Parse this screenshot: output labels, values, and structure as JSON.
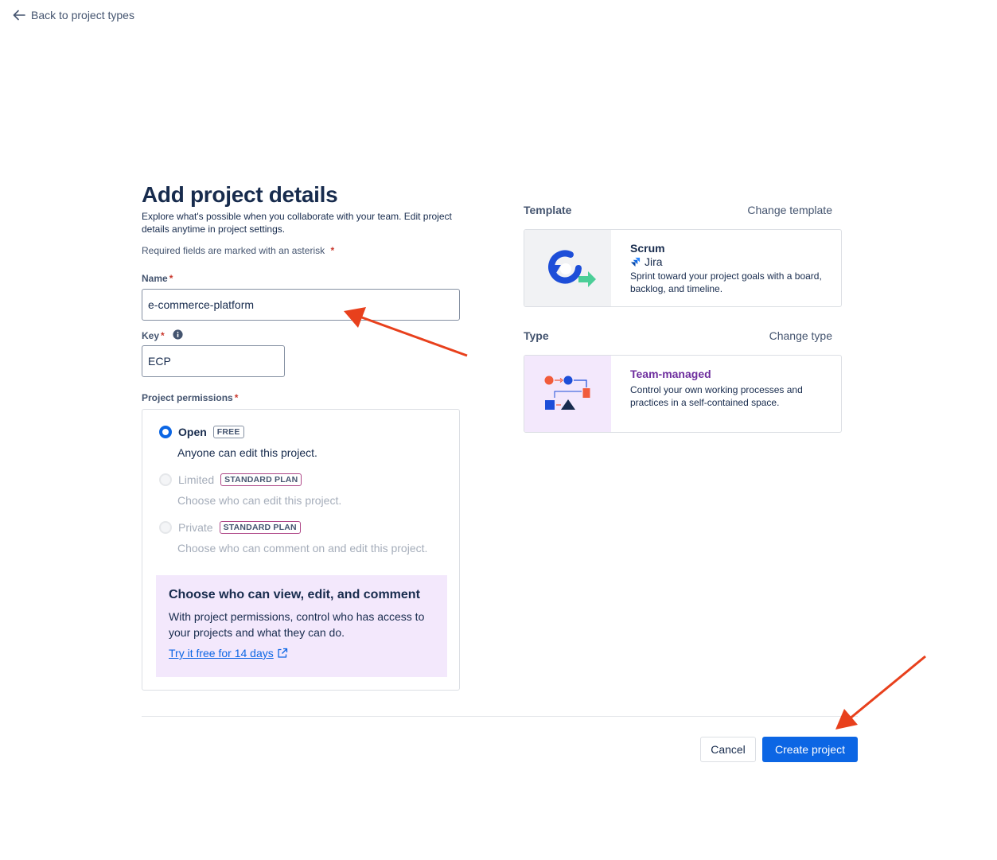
{
  "nav": {
    "back_label": "Back to project types"
  },
  "header": {
    "title": "Add project details",
    "description": "Explore what's possible when you collaborate with your team. Edit project details anytime in project settings.",
    "required_note": "Required fields are marked with an asterisk",
    "asterisk": "*"
  },
  "form": {
    "name": {
      "label": "Name",
      "value": "e-commerce-platform"
    },
    "key": {
      "label": "Key",
      "value": "ECP"
    },
    "permissions": {
      "label": "Project permissions",
      "options": [
        {
          "label": "Open",
          "badge": "FREE",
          "description": "Anyone can edit this project.",
          "selected": true,
          "disabled": false
        },
        {
          "label": "Limited",
          "badge": "STANDARD PLAN",
          "description": "Choose who can edit this project.",
          "selected": false,
          "disabled": true
        },
        {
          "label": "Private",
          "badge": "STANDARD PLAN",
          "description": "Choose who can comment on and edit this project.",
          "selected": false,
          "disabled": true
        }
      ],
      "upsell": {
        "title": "Choose who can view, edit, and comment",
        "body": "With project permissions, control who has access to your projects and what they can do.",
        "link": "Try it free for 14 days"
      }
    }
  },
  "template": {
    "heading": "Template",
    "action": "Change template",
    "name": "Scrum",
    "product": "Jira",
    "description": "Sprint toward your project goals with a board, backlog, and timeline."
  },
  "type": {
    "heading": "Type",
    "action": "Change type",
    "name": "Team-managed",
    "description": "Control your own working processes and practices in a self-contained space."
  },
  "footer": {
    "cancel_label": "Cancel",
    "create_label": "Create project"
  },
  "colors": {
    "primary": "#0c66e4",
    "danger": "#c9372c",
    "annotation_arrow": "#e8401c",
    "upsell_bg": "#f3e8fc",
    "team_managed": "#6e2e9e"
  }
}
